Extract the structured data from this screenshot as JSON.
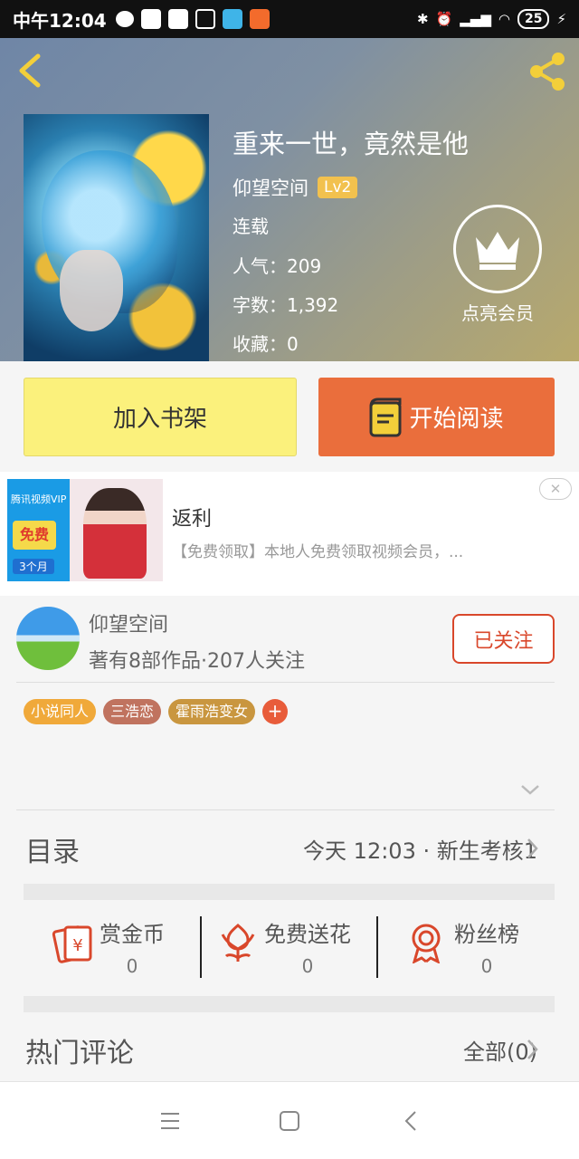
{
  "status_bar": {
    "time": "中午12:04",
    "battery": "25"
  },
  "header": {
    "book_title": "重来一世，竟然是他",
    "author": "仰望空间",
    "level": "Lv2",
    "status": "连载",
    "popularity": "人气：209",
    "word_count": "字数：1,392",
    "favorites": "收藏：0",
    "vip_label": "点亮会员"
  },
  "actions": {
    "add_shelf": "加入书架",
    "start_reading": "开始阅读"
  },
  "ad": {
    "image_top_text": "腾讯视频VIP",
    "image_badge": "免费",
    "image_months": "3个月",
    "title": "返利",
    "description": "【免费领取】本地人免费领取视频会员，..."
  },
  "author_section": {
    "name": "仰望空间",
    "stats": "著有8部作品·207人关注",
    "follow_label": "已关注",
    "tags": [
      {
        "label": "小说同人",
        "color": "#f0a93a"
      },
      {
        "label": "三浩恋",
        "color": "#c0735f"
      },
      {
        "label": "霍雨浩变女",
        "color": "#c9963f"
      }
    ],
    "tag_add": "+"
  },
  "catalog": {
    "title": "目录",
    "latest": "今天 12:03 · 新生考核1"
  },
  "stats": [
    {
      "label": "赏金币",
      "value": "0",
      "icon": "red-envelope-icon"
    },
    {
      "label": "免费送花",
      "value": "0",
      "icon": "flower-icon"
    },
    {
      "label": "粉丝榜",
      "value": "0",
      "icon": "medal-icon"
    }
  ],
  "comments": {
    "title": "热门评论",
    "all_label": "全部(0)"
  },
  "colors": {
    "accent_orange": "#ea6e3c",
    "shelf_yellow": "#fbf17c",
    "icon_red": "#d9472b"
  }
}
